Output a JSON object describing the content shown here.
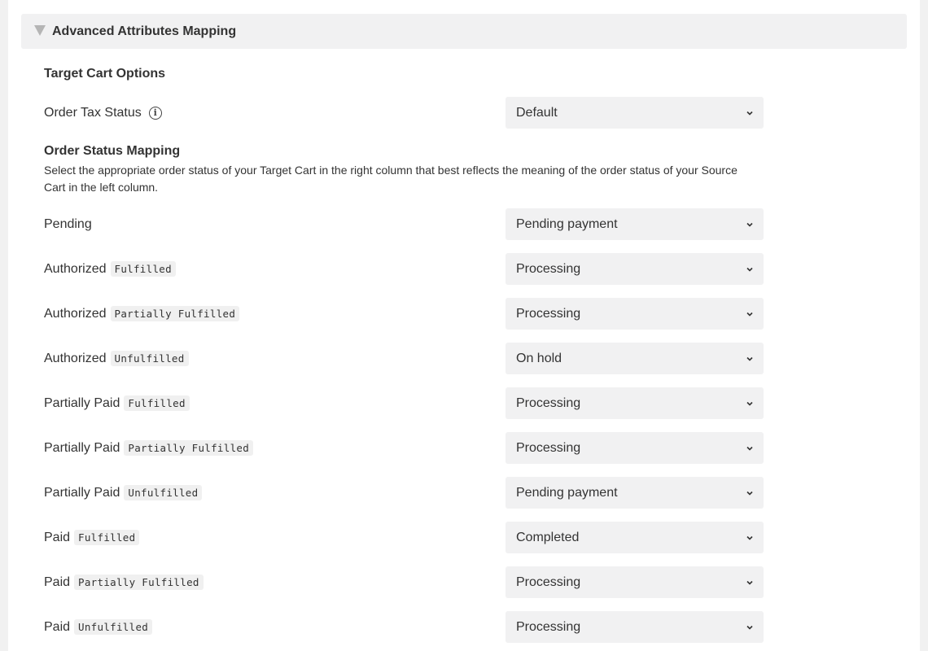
{
  "accordion": {
    "title": "Advanced Attributes Mapping"
  },
  "target_cart": {
    "title": "Target Cart Options"
  },
  "tax_status": {
    "label": "Order Tax Status",
    "info_glyph": "i",
    "value": "Default"
  },
  "status_mapping": {
    "title": "Order Status Mapping",
    "description": "Select the appropriate order status of your Target Cart in the right column that best reflects the meaning of the order status of your Source Cart in the left column.",
    "rows": [
      {
        "label": "Pending",
        "tag": "",
        "value": "Pending payment"
      },
      {
        "label": "Authorized",
        "tag": "Fulfilled",
        "value": "Processing"
      },
      {
        "label": "Authorized",
        "tag": "Partially Fulfilled",
        "value": "Processing"
      },
      {
        "label": "Authorized",
        "tag": "Unfulfilled",
        "value": "On hold"
      },
      {
        "label": "Partially Paid",
        "tag": "Fulfilled",
        "value": "Processing"
      },
      {
        "label": "Partially Paid",
        "tag": "Partially Fulfilled",
        "value": "Processing"
      },
      {
        "label": "Partially Paid",
        "tag": "Unfulfilled",
        "value": "Pending payment"
      },
      {
        "label": "Paid",
        "tag": "Fulfilled",
        "value": "Completed"
      },
      {
        "label": "Paid",
        "tag": "Partially Fulfilled",
        "value": "Processing"
      },
      {
        "label": "Paid",
        "tag": "Unfulfilled",
        "value": "Processing"
      }
    ]
  },
  "icons": {
    "collapse": "triangle-down-icon",
    "info": "info-circle-icon",
    "select": "chevron-down-icon"
  }
}
